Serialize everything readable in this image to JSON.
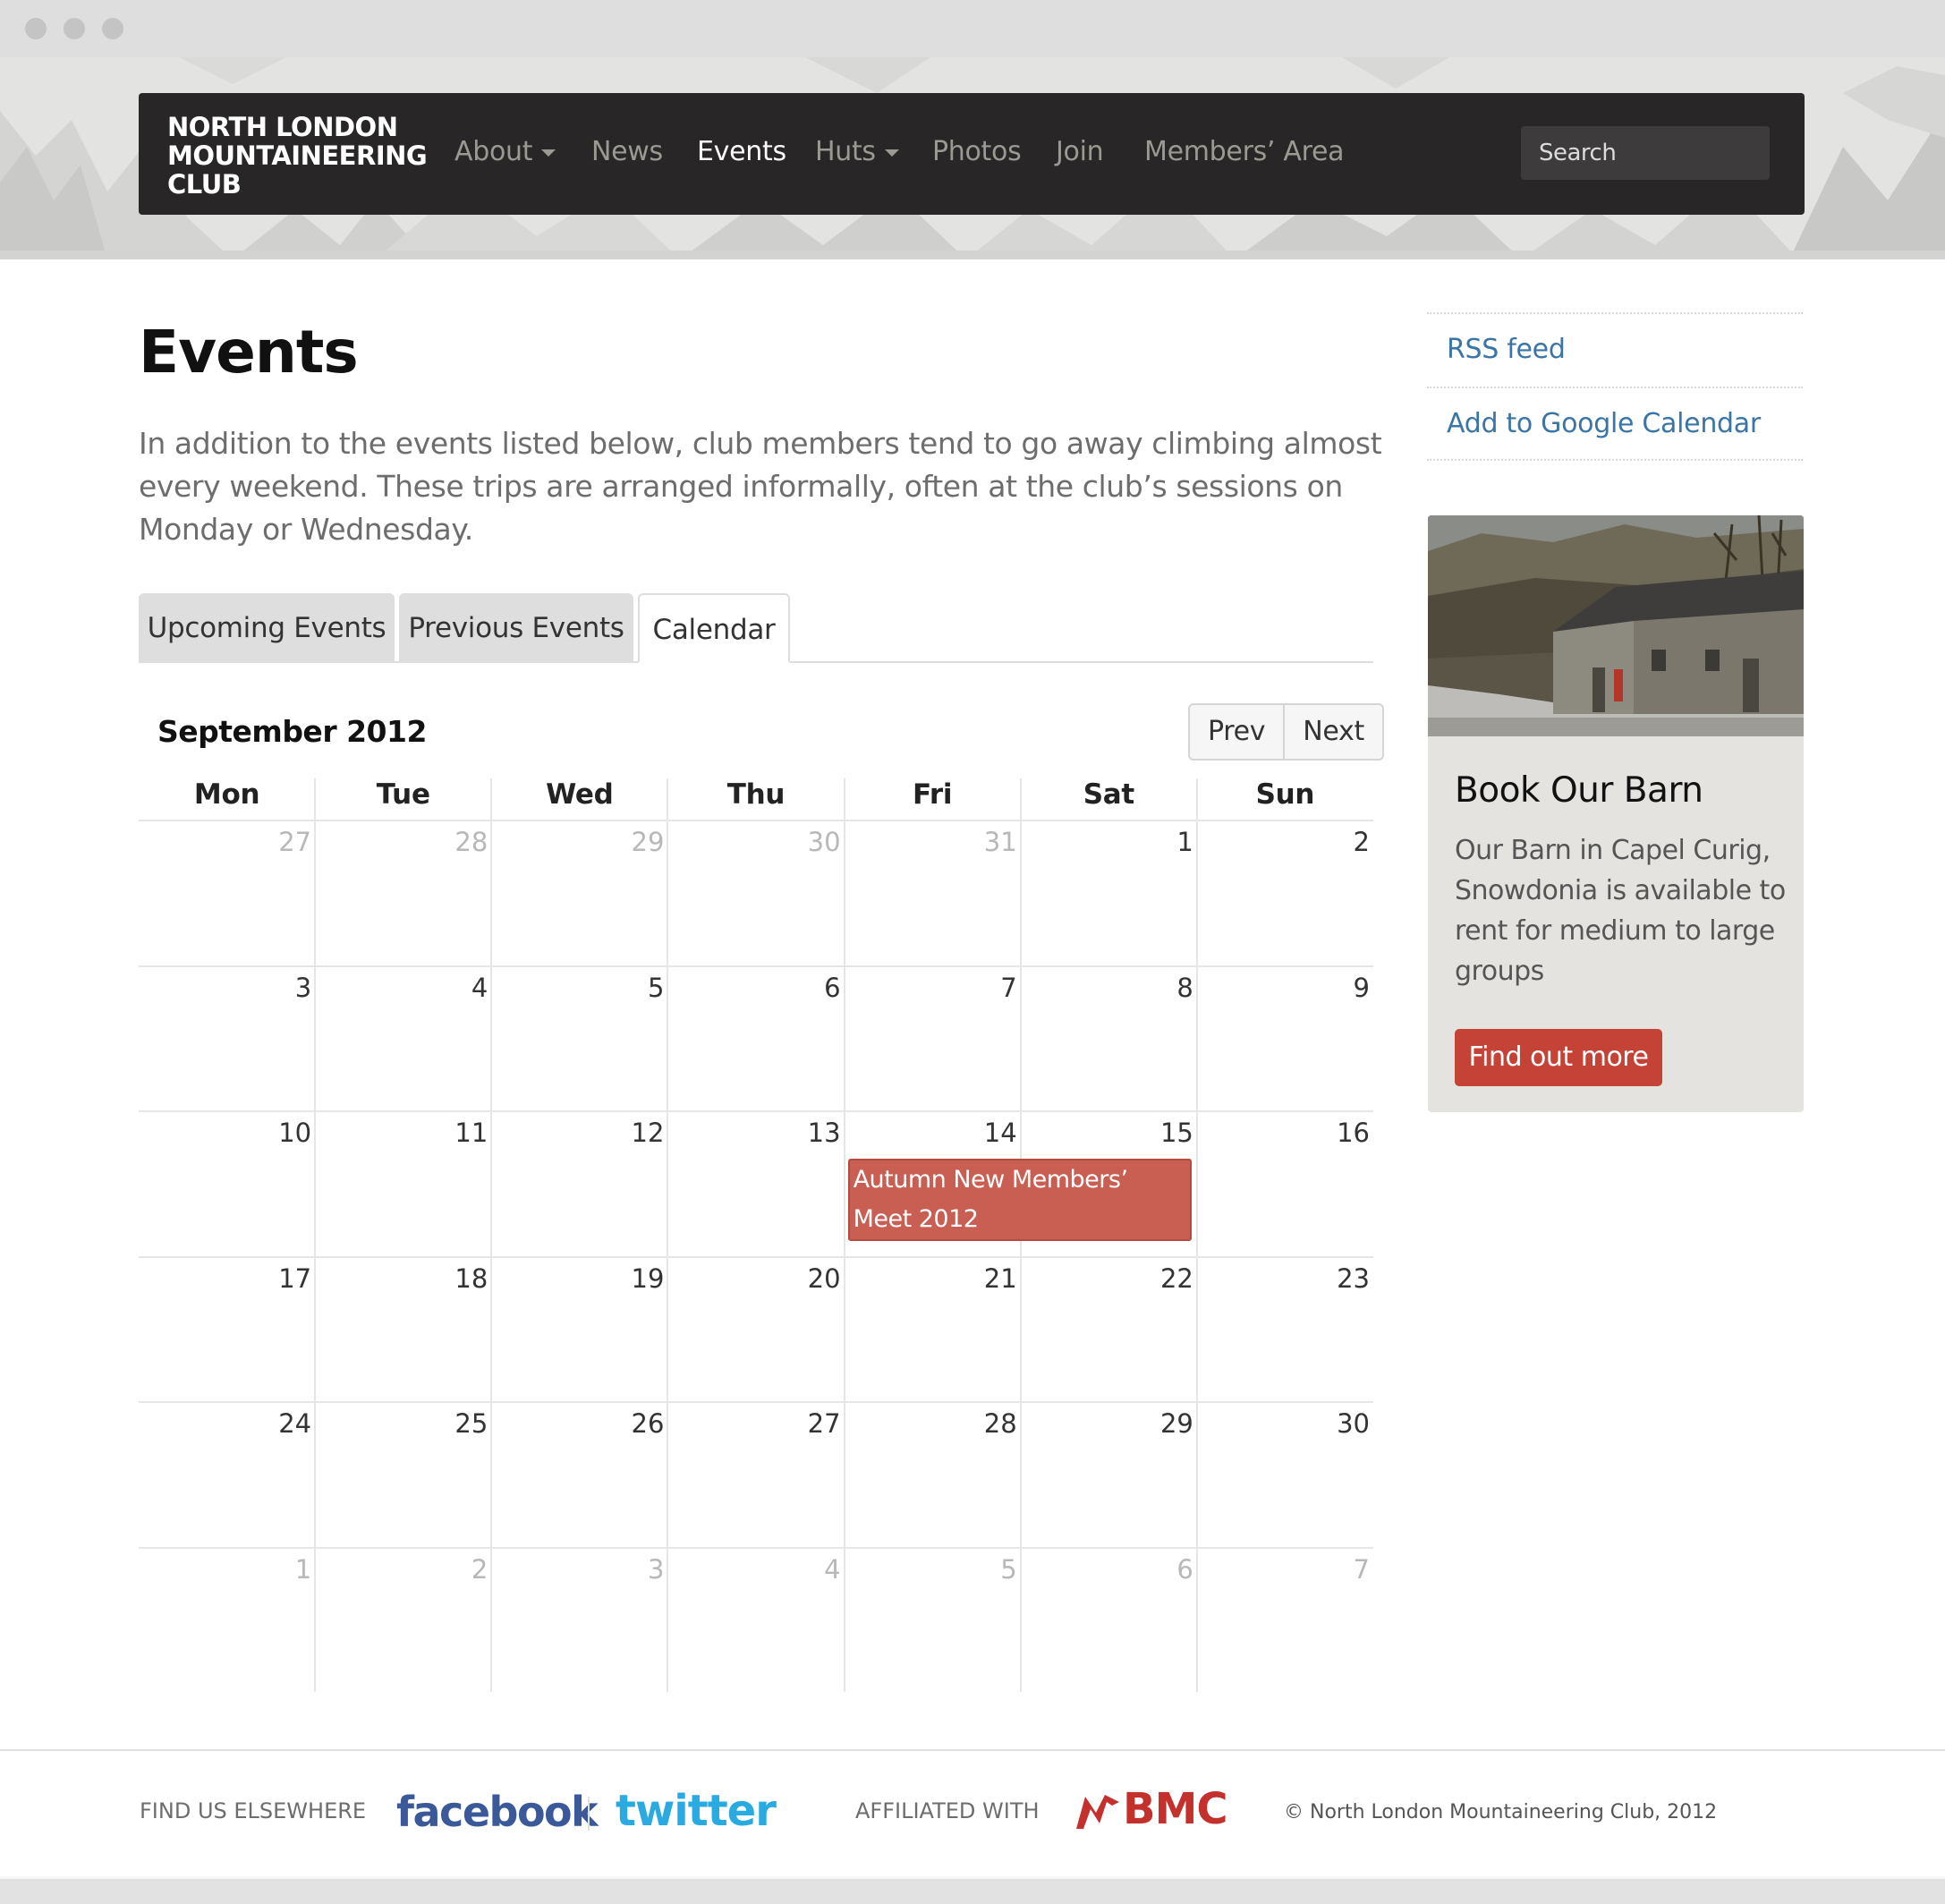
{
  "navbar": {
    "brand_lines": [
      "NORTH LONDON",
      "MOUNTAINEERING",
      "CLUB"
    ],
    "items": [
      {
        "label": "About",
        "dropdown": true
      },
      {
        "label": "News",
        "dropdown": false
      },
      {
        "label": "Events",
        "dropdown": false,
        "active": true
      },
      {
        "label": "Huts",
        "dropdown": true
      },
      {
        "label": "Photos",
        "dropdown": false
      },
      {
        "label": "Join",
        "dropdown": false
      },
      {
        "label": "Members’ Area",
        "dropdown": false
      }
    ],
    "search_placeholder": "Search"
  },
  "main": {
    "title": "Events",
    "intro": "In addition to the events listed below, club members tend to go away climbing almost every weekend. These trips are arranged informally, often at the club’s sessions on Monday or Wednesday.",
    "tabs": [
      {
        "label": "Upcoming Events",
        "active": false
      },
      {
        "label": "Previous Events",
        "active": false
      },
      {
        "label": "Calendar",
        "active": true
      }
    ]
  },
  "calendar": {
    "month": "September 2012",
    "prev_label": "Prev",
    "next_label": "Next",
    "weekdays": [
      "Mon",
      "Tue",
      "Wed",
      "Thu",
      "Fri",
      "Sat",
      "Sun"
    ],
    "weeks": [
      [
        {
          "d": "27",
          "muted": true
        },
        {
          "d": "28",
          "muted": true
        },
        {
          "d": "29",
          "muted": true
        },
        {
          "d": "30",
          "muted": true
        },
        {
          "d": "31",
          "muted": true
        },
        {
          "d": "1"
        },
        {
          "d": "2"
        }
      ],
      [
        {
          "d": "3"
        },
        {
          "d": "4"
        },
        {
          "d": "5"
        },
        {
          "d": "6"
        },
        {
          "d": "7"
        },
        {
          "d": "8"
        },
        {
          "d": "9"
        }
      ],
      [
        {
          "d": "10"
        },
        {
          "d": "11"
        },
        {
          "d": "12"
        },
        {
          "d": "13"
        },
        {
          "d": "14"
        },
        {
          "d": "15"
        },
        {
          "d": "16"
        }
      ],
      [
        {
          "d": "17"
        },
        {
          "d": "18"
        },
        {
          "d": "19"
        },
        {
          "d": "20"
        },
        {
          "d": "21"
        },
        {
          "d": "22"
        },
        {
          "d": "23"
        }
      ],
      [
        {
          "d": "24"
        },
        {
          "d": "25"
        },
        {
          "d": "26"
        },
        {
          "d": "27"
        },
        {
          "d": "28"
        },
        {
          "d": "29"
        },
        {
          "d": "30"
        }
      ],
      [
        {
          "d": "1",
          "muted": true
        },
        {
          "d": "2",
          "muted": true
        },
        {
          "d": "3",
          "muted": true
        },
        {
          "d": "4",
          "muted": true
        },
        {
          "d": "5",
          "muted": true
        },
        {
          "d": "6",
          "muted": true
        },
        {
          "d": "7",
          "muted": true
        }
      ]
    ],
    "event": {
      "title": "Autumn New Members’ Meet 2012",
      "start": "14",
      "end": "15",
      "color": "#c85f52"
    }
  },
  "sidebar": {
    "links": [
      "RSS feed",
      "Add to Google Calendar"
    ],
    "barn": {
      "title": "Book Our Barn",
      "text": "Our Barn in Capel Curig, Snowdonia is available to rent for medium to large groups",
      "button": "Find out more"
    }
  },
  "footer": {
    "find_us": "FIND US ELSEWHERE",
    "facebook": "facebook",
    "twitter": "twitter",
    "affiliated": "AFFILIATED WITH",
    "bmc": "BMC",
    "copyright": "© North London Mountaineering Club, 2012"
  },
  "colors": {
    "navbar_bg": "#282626",
    "link": "#3a75a5",
    "event": "#c85f52",
    "button": "#c44336",
    "facebook": "#3b5998",
    "twitter": "#29aae1",
    "bmc": "#c4302b"
  }
}
